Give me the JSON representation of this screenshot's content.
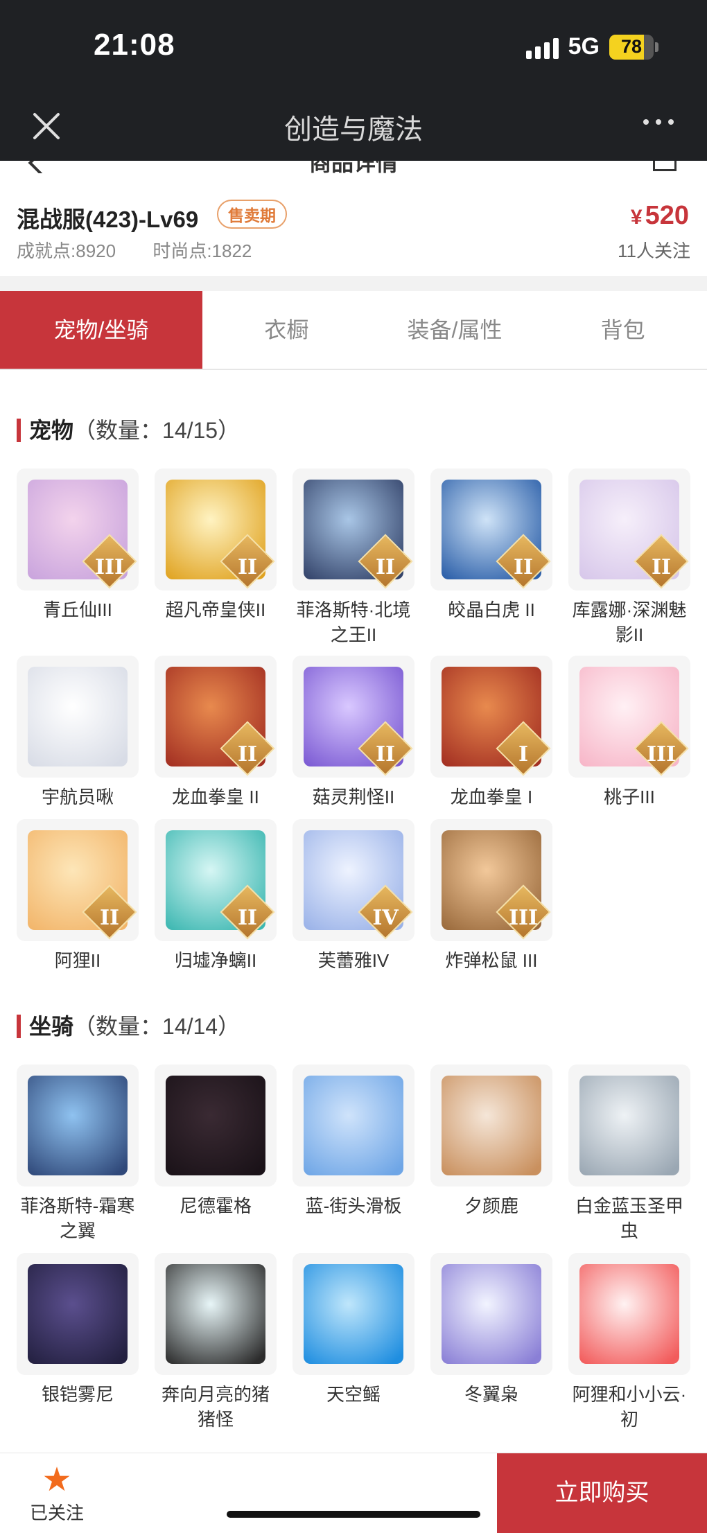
{
  "status": {
    "time": "21:08",
    "network": "5G",
    "battery": "78",
    "battery_level": 0.78
  },
  "nav": {
    "title": "创造与魔法"
  },
  "sub": {
    "title": "商品详情"
  },
  "product": {
    "server": "混战服(423)-Lv69",
    "badge": "售卖期",
    "achievement_label": "成就点:",
    "achievement": "8920",
    "fashion_label": "时尚点:",
    "fashion": "1822",
    "price_symbol": "¥",
    "price": "520",
    "followers": "11人关注"
  },
  "tabs": [
    "宠物/坐骑",
    "衣橱",
    "装备/属性",
    "背包"
  ],
  "pets": {
    "title": "宠物",
    "count": "（数量：14/15）",
    "items": [
      {
        "name": "青丘仙III",
        "tier": "III",
        "icon": "fox-fairy-icon",
        "colors": [
          "#f3d3ec",
          "#c9a4dd"
        ]
      },
      {
        "name": "超凡帝皇侠II",
        "tier": "II",
        "icon": "golden-knight-icon",
        "colors": [
          "#fff3c2",
          "#e0a321"
        ]
      },
      {
        "name": "菲洛斯特·北境之王II",
        "tier": "II",
        "icon": "frost-king-icon",
        "colors": [
          "#a9c6e6",
          "#33436a"
        ]
      },
      {
        "name": "皎晶白虎 II",
        "tier": "II",
        "icon": "white-tiger-icon",
        "colors": [
          "#cfe3f7",
          "#2a5ea8"
        ]
      },
      {
        "name": "库露娜·深渊魅影II",
        "tier": "II",
        "icon": "abyss-phantom-icon",
        "colors": [
          "#f6effa",
          "#d7c7ea"
        ]
      },
      {
        "name": "宇航员啾",
        "tier": "",
        "icon": "astronaut-icon",
        "colors": [
          "#ffffff",
          "#d8dce6"
        ]
      },
      {
        "name": "龙血拳皇 II",
        "tier": "II",
        "icon": "dragon-boxer-icon",
        "colors": [
          "#e88a4e",
          "#a32f22"
        ]
      },
      {
        "name": "菇灵荆怪II",
        "tier": "II",
        "icon": "mushroom-spirit-icon",
        "colors": [
          "#d9c8ff",
          "#7b5ad3"
        ]
      },
      {
        "name": "龙血拳皇 I",
        "tier": "I",
        "icon": "dragon-boxer-icon",
        "colors": [
          "#e88a4e",
          "#a32f22"
        ]
      },
      {
        "name": "桃子III",
        "tier": "III",
        "icon": "peach-cat-icon",
        "colors": [
          "#fff0f4",
          "#f7b6c8"
        ]
      },
      {
        "name": "阿狸II",
        "tier": "II",
        "icon": "ali-fox-icon",
        "colors": [
          "#fde6b8",
          "#f2b56a"
        ]
      },
      {
        "name": "归墟净螭II",
        "tier": "II",
        "icon": "jade-dragon-icon",
        "colors": [
          "#d6f6f4",
          "#3cb7b1"
        ]
      },
      {
        "name": "芙蕾雅IV",
        "tier": "IV",
        "icon": "valkyrie-icon",
        "colors": [
          "#eef3ff",
          "#9ab2e8"
        ]
      },
      {
        "name": "炸弹松鼠 III",
        "tier": "III",
        "icon": "bomb-squirrel-icon",
        "colors": [
          "#f2c89a",
          "#9a6a3c"
        ]
      }
    ]
  },
  "mounts": {
    "title": "坐骑",
    "count": "（数量：14/14）",
    "items": [
      {
        "name": "菲洛斯特-霜寒之翼",
        "icon": "frost-wing-icon",
        "colors": [
          "#8fc2f0",
          "#30497a"
        ]
      },
      {
        "name": "尼德霍格",
        "icon": "black-dragon-icon",
        "colors": [
          "#3a2a33",
          "#1a1218"
        ]
      },
      {
        "name": "蓝-街头滑板",
        "icon": "skateboard-icon",
        "colors": [
          "#cfe3fb",
          "#6fa6e6"
        ]
      },
      {
        "name": "夕颜鹿",
        "icon": "deer-icon",
        "colors": [
          "#f5e6d8",
          "#c9905e"
        ]
      },
      {
        "name": "白金蓝玉圣甲虫",
        "icon": "scarab-icon",
        "colors": [
          "#eef2f5",
          "#9aa7b3"
        ]
      },
      {
        "name": "银铠雾尼",
        "icon": "armored-beast-icon",
        "colors": [
          "#5b4f8e",
          "#232040"
        ]
      },
      {
        "name": "奔向月亮的猪猪怪",
        "icon": "moon-pig-icon",
        "colors": [
          "#e8f6f8",
          "#2c2c2c"
        ]
      },
      {
        "name": "天空鳐",
        "icon": "sky-ray-icon",
        "colors": [
          "#bfe6fb",
          "#1f8ee0"
        ]
      },
      {
        "name": "冬翼枭",
        "icon": "winter-owl-icon",
        "colors": [
          "#f2f4ff",
          "#8a7fd6"
        ]
      },
      {
        "name": "阿狸和小小云·初",
        "icon": "ali-cloud-icon",
        "colors": [
          "#fff2f2",
          "#f25b5b"
        ]
      }
    ]
  },
  "bottom": {
    "follow_label": "已关注",
    "buy_label": "立即购买"
  }
}
